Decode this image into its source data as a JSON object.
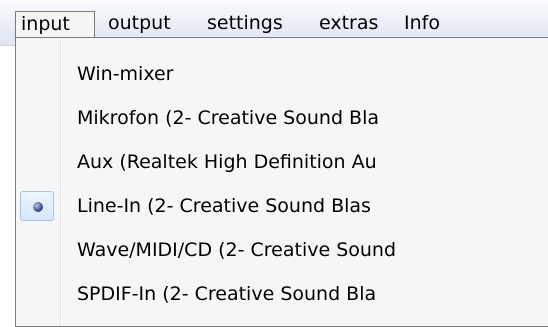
{
  "menubar": {
    "items": [
      {
        "label": "input",
        "open": true
      },
      {
        "label": "output"
      },
      {
        "label": "settings"
      },
      {
        "label": "extras"
      },
      {
        "label": "Info"
      }
    ]
  },
  "dropdown": {
    "items": [
      {
        "label": "Win-mixer",
        "selected": false
      },
      {
        "label": "Mikrofon (2- Creative Sound Bla",
        "selected": false
      },
      {
        "label": "Aux (Realtek High Definition Au",
        "selected": false
      },
      {
        "label": "Line-In (2- Creative Sound Blas",
        "selected": true
      },
      {
        "label": "Wave/MIDI/CD (2- Creative Sound",
        "selected": false
      },
      {
        "label": "SPDIF-In (2- Creative Sound Bla",
        "selected": false
      }
    ]
  }
}
